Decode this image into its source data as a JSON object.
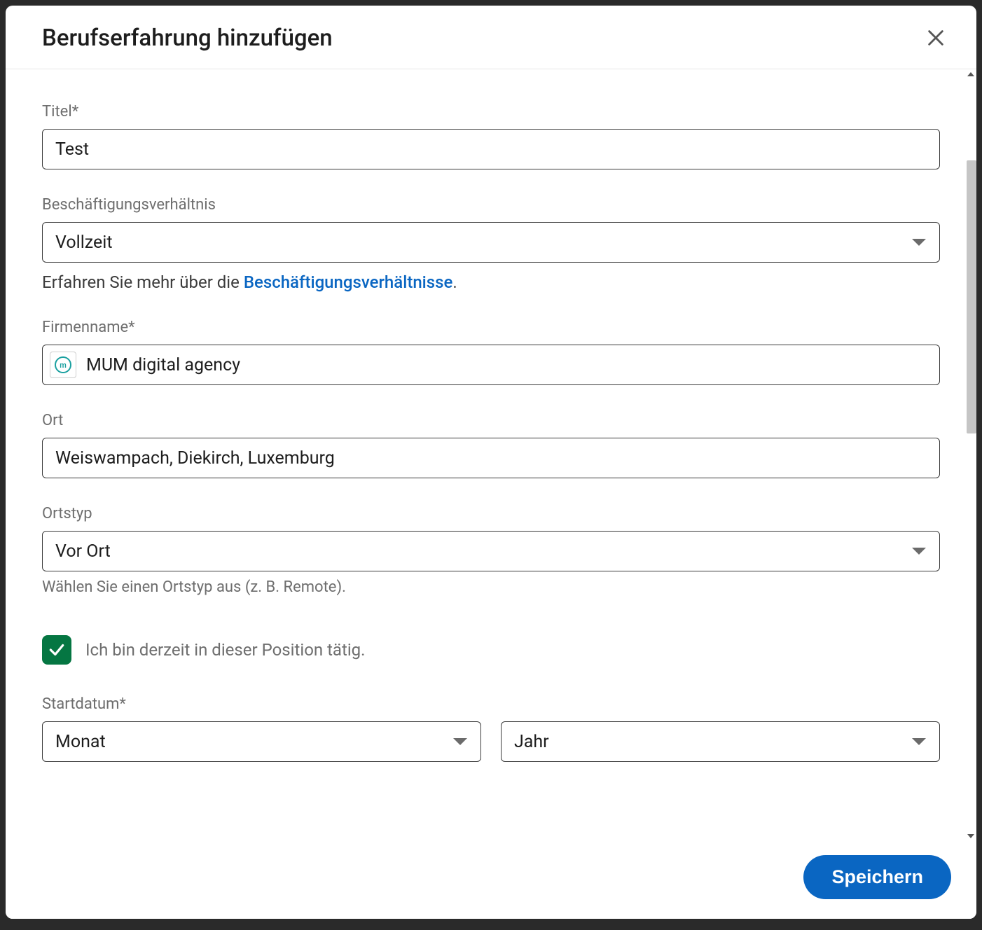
{
  "modal": {
    "title": "Berufserfahrung hinzufügen"
  },
  "fields": {
    "title": {
      "label": "Titel*",
      "value": "Test"
    },
    "employmentType": {
      "label": "Beschäftigungsverhältnis",
      "value": "Vollzeit",
      "helpPrefix": "Erfahren Sie mehr über die ",
      "helpLink": "Beschäftigungsverhältnisse",
      "helpSuffix": "."
    },
    "company": {
      "label": "Firmenname*",
      "value": "MUM digital agency",
      "logoGlyph": "m"
    },
    "location": {
      "label": "Ort",
      "value": "Weiswampach, Diekirch, Luxemburg"
    },
    "locationType": {
      "label": "Ortstyp",
      "value": "Vor Ort",
      "help": "Wählen Sie einen Ortstyp aus (z. B. Remote)."
    },
    "currentPosition": {
      "label": "Ich bin derzeit in dieser Position tätig.",
      "checked": true
    },
    "startDate": {
      "label": "Startdatum*",
      "month": "Monat",
      "year": "Jahr"
    }
  },
  "footer": {
    "save": "Speichern"
  }
}
